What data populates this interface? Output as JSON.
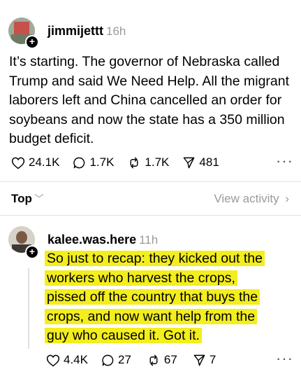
{
  "post1": {
    "username": "jimmijettt",
    "time": "16h",
    "text": "It’s starting. The governor of Nebraska called Trump and said We Need Help. All the migrant laborers left and China cancelled an order for soybeans and now the state has a 350 million budget deficit.",
    "likes": "24.1K",
    "replies": "1.7K",
    "reposts": "1.7K",
    "shares": "481"
  },
  "sort": {
    "label": "Top",
    "view_activity": "View activity"
  },
  "post2": {
    "username": "kalee.was.here",
    "time": "11h",
    "text_lines": [
      "So just to recap: they kicked out the",
      "workers who harvest the crops,",
      "pissed off the country that buys the",
      "crops, and now want help from the",
      "guy who caused it. Got it."
    ],
    "likes": "4.4K",
    "replies": "27",
    "reposts": "67",
    "shares": "7"
  },
  "icons": {
    "like": "heart-icon",
    "reply": "speech-bubble-icon",
    "repost": "repost-arrows-icon",
    "share": "send-icon",
    "more": "ellipsis-icon",
    "follow": "plus-icon"
  },
  "colors": {
    "highlight": "#f3ee1d",
    "muted": "#9a9a9a"
  }
}
